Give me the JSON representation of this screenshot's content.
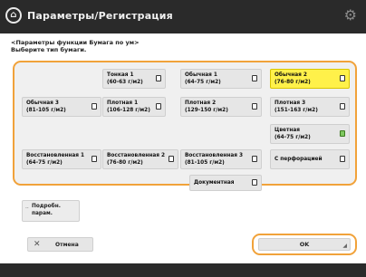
{
  "header": {
    "title": "Параметры/Регистрация",
    "home_icon": "home-icon",
    "settings_icon": "gear-icon"
  },
  "instruction": {
    "line1": "<Параметры функции Бумага по ум>",
    "line2": "Выберите тип бумаги."
  },
  "grid": {
    "accent_color": "#f1a23a",
    "selected_color": "#fff14a",
    "tiles": [
      {
        "label": "Тонкая 1\n(60-63 г/м2)",
        "icon": "paper-icon",
        "selected": false
      },
      {
        "label": "Обычная 1\n(64-75 г/м2)",
        "icon": "paper-icon",
        "selected": false
      },
      {
        "label": "Обычная 2\n(76-80 г/м2)",
        "icon": "paper-icon",
        "selected": true
      },
      {
        "label": "Обычная 3\n(81-105 г/м2)",
        "icon": "paper-icon",
        "selected": false
      },
      {
        "label": "Плотная 1\n(106-128 г/м2)",
        "icon": "paper-icon",
        "selected": false
      },
      {
        "label": "Плотная 2\n(129-150 г/м2)",
        "icon": "paper-icon",
        "selected": false
      },
      {
        "label": "Плотная 3\n(151-163 г/м2)",
        "icon": "paper-icon",
        "selected": false
      },
      {
        "label": "Цветная\n(64-75 г/м2)",
        "icon": "color-paper-icon",
        "selected": false
      },
      {
        "label": "Восстановленная 1\n(64-75 г/м2)",
        "icon": "recycled-paper-icon",
        "selected": false
      },
      {
        "label": "Восстановленная 2\n(76-80 г/м2)",
        "icon": "recycled-paper-icon",
        "selected": false
      },
      {
        "label": "Восстановленная 3\n(81-105 г/м2)",
        "icon": "recycled-paper-icon",
        "selected": false
      },
      {
        "label": "С перфорацией",
        "icon": "punched-paper-icon",
        "selected": false
      },
      {
        "label": "Документная",
        "icon": "bond-paper-icon",
        "selected": false
      }
    ]
  },
  "details_button": {
    "label": "Подробн.\nпарам.",
    "icon": "dots-icon"
  },
  "cancel_button": {
    "label": "Отмена",
    "icon": "close-icon"
  },
  "ok_button": {
    "label": "OK"
  }
}
